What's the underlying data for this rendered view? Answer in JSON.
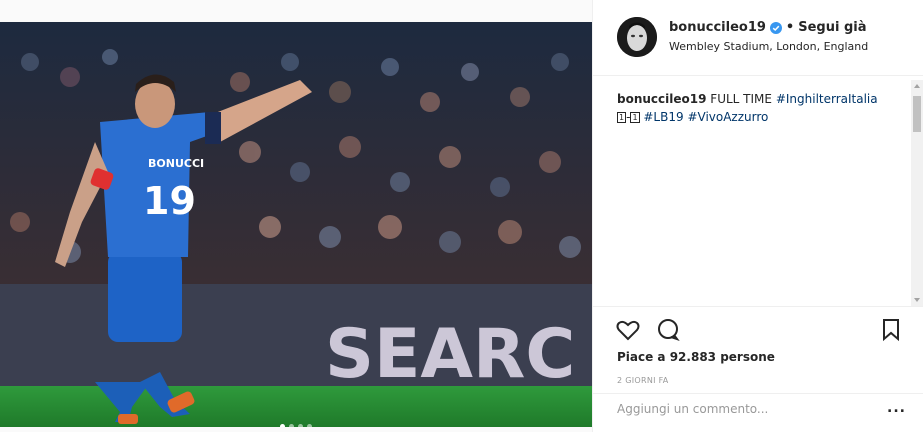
{
  "post": {
    "photo_alt": "",
    "carousel": {
      "count": 4,
      "active": 0
    }
  },
  "header": {
    "username": "bonuccileo19",
    "separator": "•",
    "follow_label": "Segui già",
    "location": "Wembley Stadium, London, England"
  },
  "caption": {
    "username": "bonuccileo19",
    "text": "FULL TIME",
    "tag1": "#InghilterraItalia",
    "score_home": "1",
    "score_sep": "-",
    "score_away": "1",
    "tag2": "#LB19",
    "tag3": "#VivoAzzurro"
  },
  "actions": {
    "icons": [
      "heart-icon",
      "comment-icon",
      "bookmark-icon"
    ],
    "likes": "Piace a 92.883 persone",
    "time": "2 GIORNI FA",
    "comment_placeholder": "Aggiungi un commento...",
    "more": "..."
  },
  "colors": {
    "link": "#003569",
    "verified": "#3897f0",
    "text": "#262626",
    "muted": "#999999"
  }
}
